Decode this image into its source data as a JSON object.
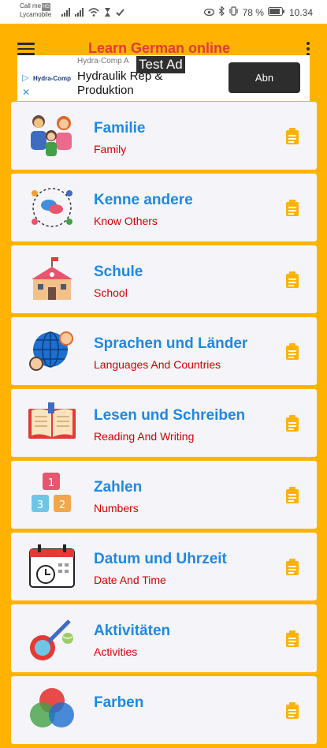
{
  "status_bar": {
    "carrier_line1": "Call me",
    "carrier_badge": "HD",
    "carrier_line2": "Lycamobile",
    "battery": "78 %",
    "time": "10.34"
  },
  "toolbar": {
    "title": "Learn German online"
  },
  "ad": {
    "logo_text": "Hydra-Comp",
    "advertiser": "Hydra-Comp A",
    "headline": "Hydraulik Rep & Produktion",
    "test_label": "Test Ad",
    "button_label": "Abn"
  },
  "colors": {
    "background": "#FFB300",
    "title": "#E53935",
    "item_title": "#1E88E5",
    "item_subtitle": "#D50000",
    "card": "#F5F5F9"
  },
  "categories": [
    {
      "title": "Familie",
      "subtitle": "Family",
      "icon": "family-icon"
    },
    {
      "title": "Kenne andere",
      "subtitle": "Know Others",
      "icon": "people-network-icon"
    },
    {
      "title": "Schule",
      "subtitle": "School",
      "icon": "school-building-icon"
    },
    {
      "title": "Sprachen und Länder",
      "subtitle": "Languages And Countries",
      "icon": "globe-people-icon"
    },
    {
      "title": "Lesen und Schreiben",
      "subtitle": "Reading And Writing",
      "icon": "open-book-icon"
    },
    {
      "title": "Zahlen",
      "subtitle": "Numbers",
      "icon": "number-blocks-icon"
    },
    {
      "title": "Datum und Uhrzeit",
      "subtitle": "Date And Time",
      "icon": "calendar-clock-icon"
    },
    {
      "title": "Aktivitäten",
      "subtitle": "Activities",
      "icon": "sports-icon"
    },
    {
      "title": "Farben",
      "subtitle": "",
      "icon": "colors-icon"
    }
  ]
}
